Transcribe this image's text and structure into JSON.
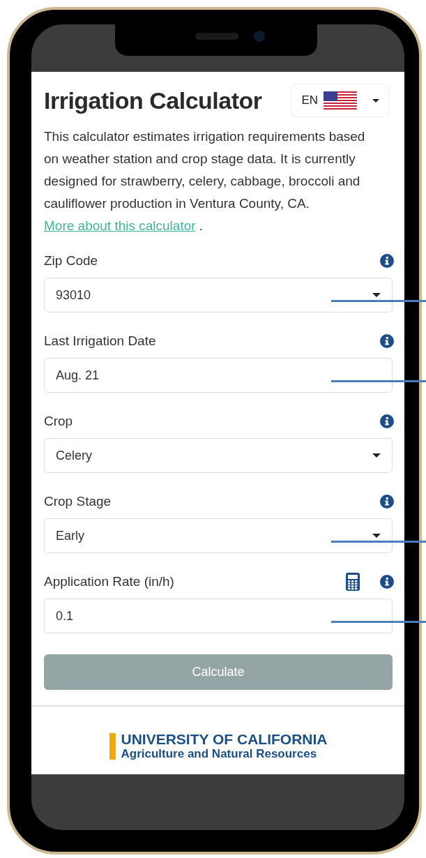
{
  "header": {
    "title": "Irrigation Calculator",
    "language": {
      "code": "EN"
    }
  },
  "description": {
    "text": "This calculator estimates irrigation requirements based on weather station and crop stage data. It is currently designed for strawberry, celery, cabbage, broccoli and cauliflower production in Ventura County, CA.",
    "link": "More about this calculator",
    "after": "."
  },
  "fields": [
    {
      "label": "Zip Code",
      "kind": "select",
      "value": "93010",
      "calculator": false,
      "annotated": true
    },
    {
      "label": "Last Irrigation Date",
      "kind": "text",
      "value": "Aug. 21",
      "calculator": false,
      "annotated": true
    },
    {
      "label": "Crop",
      "kind": "select",
      "value": "Celery",
      "calculator": false,
      "annotated": false
    },
    {
      "label": "Crop Stage",
      "kind": "select",
      "value": "Early",
      "calculator": false,
      "annotated": true
    },
    {
      "label": "Application Rate (in/h)",
      "kind": "text",
      "value": "0.1",
      "calculator": true,
      "annotated": true
    }
  ],
  "button": {
    "label": "Calculate",
    "disabled": true
  },
  "footer": {
    "logo_line_1": "UNIVERSITY OF CALIFORNIA",
    "logo_line_2": "Agriculture and Natural Resources"
  }
}
